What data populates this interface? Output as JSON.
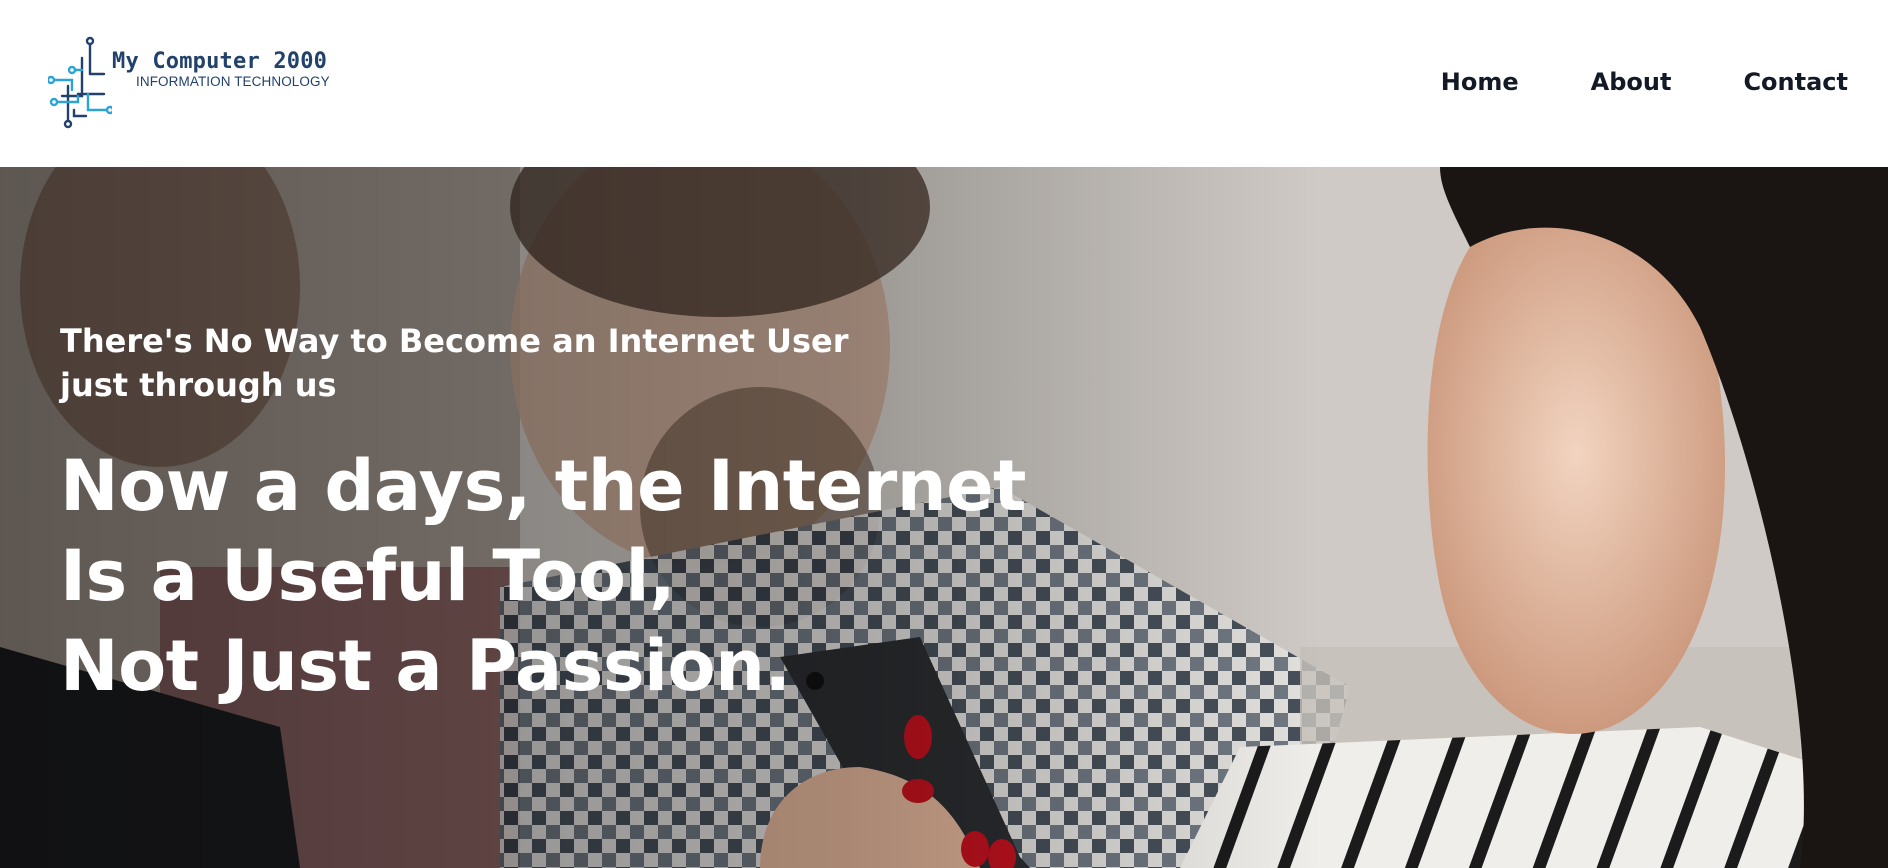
{
  "brand": {
    "name": "My Computer 2000",
    "tagline": "INFORMATION TECHNOLOGY",
    "logo_icon": "circuit-icon",
    "primary_color": "#22416b",
    "accent_color": "#2aa3d6"
  },
  "nav": {
    "items": [
      {
        "label": "Home"
      },
      {
        "label": "About"
      },
      {
        "label": "Contact"
      }
    ]
  },
  "hero": {
    "kicker": "There's No Way to Become an Internet User just through us",
    "headline_lines": [
      "Now a days, the Internet",
      "Is a Useful Tool,",
      "Not Just a Passion."
    ],
    "text_color": "#ffffff"
  }
}
